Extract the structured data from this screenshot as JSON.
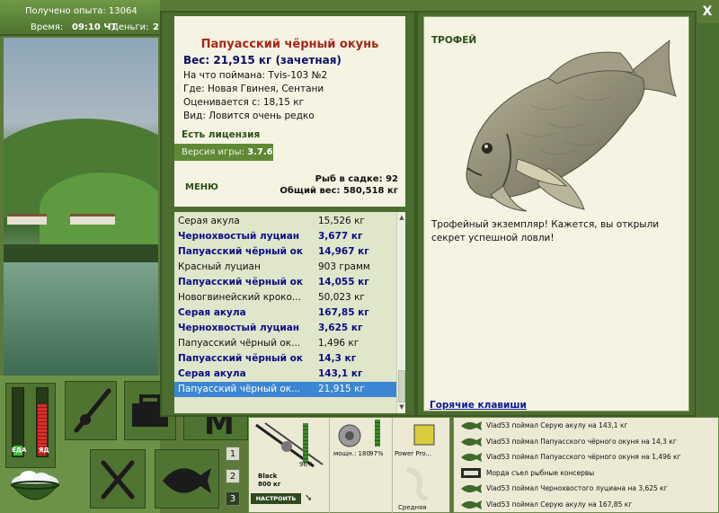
{
  "status": {
    "xp_label": "Получено опыта: 13064",
    "time_label": "Время:",
    "time_value": "09:10 ЧТ",
    "money_label": "Деньги:",
    "money_value": "2"
  },
  "meters": {
    "food_label": "ЕДА",
    "vodka_label": "ЯД",
    "food_level": 0.15,
    "vodka_level": 0.75
  },
  "fish_info": {
    "title": "Папуасский чёрный окунь",
    "weight": "Вес: 21,915 кг (зачетная)",
    "bait": "На что поймана: Tvis-103 №2",
    "location": "Где: Новая Гвинея, Сентани",
    "price": "Оценивается с: 18,15 кг",
    "rarity": "Вид: Ловится очень редко"
  },
  "license": "Есть лицензия",
  "version_label": "Версия игры:",
  "version_value": "3.7.6",
  "menu_label": "МЕНЮ",
  "keepnet": {
    "count": "Рыб в садке: 92",
    "total": "Общий вес: 580,518 кг"
  },
  "catch_list": [
    {
      "name": "Серая акула",
      "weight": "15,526 кг",
      "trophy": false,
      "selected": false
    },
    {
      "name": "Чернохвостый луциан",
      "weight": "3,677 кг",
      "trophy": true,
      "selected": false
    },
    {
      "name": "Папуасский чёрный ок...",
      "weight": "14,967 кг",
      "trophy": true,
      "selected": false
    },
    {
      "name": "Красный луциан",
      "weight": "903 грамм",
      "trophy": false,
      "selected": false
    },
    {
      "name": "Папуасский чёрный ок...",
      "weight": "14,055 кг",
      "trophy": true,
      "selected": false
    },
    {
      "name": "Новогвинейский кроко...",
      "weight": "50,023 кг",
      "trophy": false,
      "selected": false
    },
    {
      "name": "Серая акула",
      "weight": "167,85 кг",
      "trophy": true,
      "selected": false
    },
    {
      "name": "Чернохвостый луциан",
      "weight": "3,625 кг",
      "trophy": true,
      "selected": false
    },
    {
      "name": "Папуасский чёрный ок...",
      "weight": "1,496 кг",
      "trophy": false,
      "selected": false
    },
    {
      "name": "Папуасский чёрный ок...",
      "weight": "14,3 кг",
      "trophy": true,
      "selected": false
    },
    {
      "name": "Серая акула",
      "weight": "143,1 кг",
      "trophy": true,
      "selected": false
    },
    {
      "name": "Папуасский чёрный ок...",
      "weight": "21,915 кг",
      "trophy": true,
      "selected": true
    }
  ],
  "trophy": {
    "label": "ТРОФЕЙ",
    "description": "Трофейный экземпляр! Кажется, вы открыли секрет успешной ловли!",
    "hotkeys": "Горячие клавиши"
  },
  "close_glyph": "X",
  "tackle": {
    "rod_name": "Black",
    "rod_length": "800 кг",
    "rod_pct": "96%",
    "reel_power": "мощн.: 180",
    "reel_pct": "97%",
    "line_name": "Power Pro...",
    "lure_name": "Средняя",
    "set_button": "НАСТРОИТЬ"
  },
  "rod_slots": [
    "1",
    "2",
    "3"
  ],
  "log": [
    {
      "text": "Vlad53 поймал Серую акулу на 143,1 кг",
      "icon": "fish-icon"
    },
    {
      "text": "Vlad53 поймал Папуасского чёрного окуня на 14,3 кг",
      "icon": "fish-icon"
    },
    {
      "text": "Vlad53 поймал Папуасского чёрного окуня на 1,496 кг",
      "icon": "fish-icon"
    },
    {
      "text": "Морда съел рыбные консервы",
      "icon": "food-icon"
    },
    {
      "text": "Vlad53 поймал Чернохвостого луциана на 3,625 кг",
      "icon": "fish-icon"
    },
    {
      "text": "Vlad53 поймал Серую акулу на 167,85 кг",
      "icon": "fish-icon"
    }
  ],
  "colors": {
    "panel_green": "#4b6e30",
    "paper": "#f5f3e2",
    "trophy_blue": "#0a0e88",
    "title_red": "#a3281c",
    "selection": "#3c87d4"
  }
}
